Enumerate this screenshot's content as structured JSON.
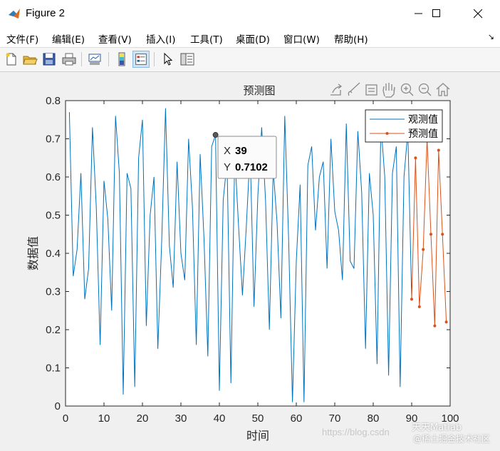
{
  "window": {
    "title": "Figure 2",
    "minimize_icon": "minimize-icon",
    "maximize_icon": "maximize-icon",
    "close_icon": "close-icon"
  },
  "menu": {
    "items": [
      {
        "label": "文件(F)"
      },
      {
        "label": "编辑(E)"
      },
      {
        "label": "查看(V)"
      },
      {
        "label": "插入(I)"
      },
      {
        "label": "工具(T)"
      },
      {
        "label": "桌面(D)"
      },
      {
        "label": "窗口(W)"
      },
      {
        "label": "帮助(H)"
      }
    ],
    "dock_arrow": "↘"
  },
  "toolbar": {
    "icons": [
      "new-figure-icon",
      "open-file-icon",
      "save-icon",
      "print-icon",
      "link-plot-icon",
      "colorbar-icon",
      "legend-icon",
      "pointer-icon",
      "property-editor-icon"
    ]
  },
  "axes_toolbar": {
    "icons": [
      "export-icon",
      "brush-icon",
      "datatip-icon",
      "pan-icon",
      "zoom-in-icon",
      "zoom-out-icon",
      "home-icon"
    ]
  },
  "datatip": {
    "x_label": "X",
    "x_value": "39",
    "y_label": "Y",
    "y_value": "0.7102"
  },
  "watermark": {
    "url": "https://blog.csdn",
    "brand_top": "天天Matlab",
    "brand_bottom": "@稀土掘金技术社区"
  },
  "colors": {
    "observed": "#0072bd",
    "predicted": "#d95319",
    "axes_bg": "#ffffff"
  },
  "chart_data": {
    "type": "line",
    "title": "预测图",
    "xlabel": "时间",
    "ylabel": "数据值",
    "xlim": [
      0,
      100
    ],
    "ylim": [
      0,
      0.8
    ],
    "xticks": [
      0,
      10,
      20,
      30,
      40,
      50,
      60,
      70,
      80,
      90,
      100
    ],
    "yticks": [
      0,
      0.1,
      0.2,
      0.3,
      0.4,
      0.5,
      0.6,
      0.7,
      0.8
    ],
    "legend_position": "top-right",
    "grid": false,
    "series": [
      {
        "name": "观测值",
        "marker": "none",
        "x": [
          1,
          2,
          3,
          4,
          5,
          6,
          7,
          8,
          9,
          10,
          11,
          12,
          13,
          14,
          15,
          16,
          17,
          18,
          19,
          20,
          21,
          22,
          23,
          24,
          25,
          26,
          27,
          28,
          29,
          30,
          31,
          32,
          33,
          34,
          35,
          36,
          37,
          38,
          39,
          40,
          41,
          42,
          43,
          44,
          45,
          46,
          47,
          48,
          49,
          50,
          51,
          52,
          53,
          54,
          55,
          56,
          57,
          58,
          59,
          60,
          61,
          62,
          63,
          64,
          65,
          66,
          67,
          68,
          69,
          70,
          71,
          72,
          73,
          74,
          75,
          76,
          77,
          78,
          79,
          80,
          81,
          82,
          83,
          84,
          85,
          86,
          87,
          88,
          89,
          90
        ],
        "y": [
          0.77,
          0.34,
          0.41,
          0.61,
          0.28,
          0.36,
          0.73,
          0.52,
          0.16,
          0.59,
          0.49,
          0.25,
          0.76,
          0.61,
          0.03,
          0.61,
          0.57,
          0.05,
          0.65,
          0.75,
          0.21,
          0.5,
          0.6,
          0.15,
          0.43,
          0.78,
          0.42,
          0.31,
          0.64,
          0.4,
          0.33,
          0.7,
          0.52,
          0.16,
          0.66,
          0.44,
          0.13,
          0.68,
          0.71,
          0.04,
          0.54,
          0.64,
          0.06,
          0.66,
          0.47,
          0.29,
          0.47,
          0.67,
          0.26,
          0.55,
          0.73,
          0.54,
          0.2,
          0.62,
          0.48,
          0.23,
          0.76,
          0.44,
          0.01,
          0.38,
          0.58,
          0.01,
          0.63,
          0.68,
          0.46,
          0.6,
          0.64,
          0.36,
          0.7,
          0.51,
          0.46,
          0.33,
          0.74,
          0.38,
          0.36,
          0.72,
          0.56,
          0.15,
          0.61,
          0.5,
          0.11,
          0.74,
          0.6,
          0.08,
          0.61,
          0.68,
          0.05,
          0.6,
          0.72,
          0.28
        ]
      },
      {
        "name": "预测值",
        "marker": "dot",
        "x": [
          90,
          91,
          92,
          93,
          94,
          95,
          96,
          97,
          98,
          99
        ],
        "y": [
          0.28,
          0.65,
          0.26,
          0.41,
          0.7,
          0.45,
          0.21,
          0.67,
          0.45,
          0.22
        ]
      }
    ]
  }
}
